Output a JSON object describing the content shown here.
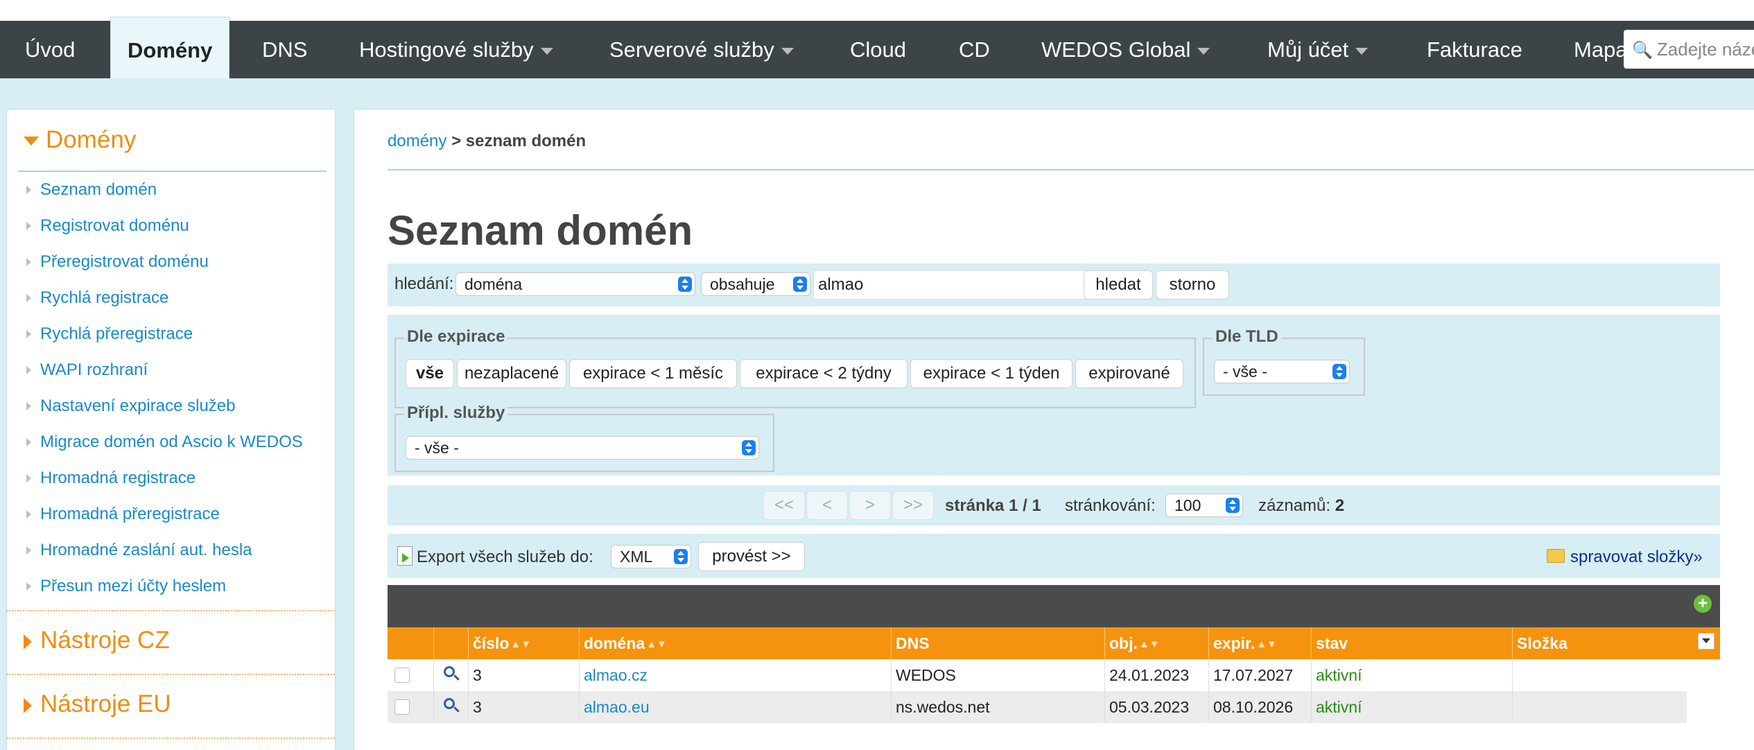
{
  "nav": {
    "items": [
      {
        "label": "Úvod"
      },
      {
        "label": "Domény"
      },
      {
        "label": "DNS"
      },
      {
        "label": "Hostingové služby"
      },
      {
        "label": "Serverové služby"
      },
      {
        "label": "Cloud"
      },
      {
        "label": "CD"
      },
      {
        "label": "WEDOS Global"
      },
      {
        "label": "Můj účet"
      },
      {
        "label": "Fakturace"
      },
      {
        "label": "Mapa"
      }
    ],
    "search_placeholder": "Zadejte náze"
  },
  "sidebar": {
    "heading": "Domény",
    "links": [
      "Seznam domén",
      "Registrovat doménu",
      "Přeregistrovat doménu",
      "Rychlá registrace",
      "Rychlá přeregistrace",
      "WAPI rozhraní",
      "Nastavení expirace služeb",
      "Migrace domén od Ascio k WEDOS",
      "Hromadná registrace",
      "Hromadná přeregistrace",
      "Hromadné zaslání aut. hesla",
      "Přesun mezi účty heslem"
    ],
    "section2": "Nástroje CZ",
    "section3": "Nástroje EU"
  },
  "breadcrumb": {
    "link": "domény",
    "sep": ">",
    "current": "seznam domén"
  },
  "page_title": "Seznam domén",
  "search": {
    "label": "hledání:",
    "field": "doména",
    "operator": "obsahuje",
    "value": "almao",
    "search_button": "hledat",
    "cancel_button": "storno"
  },
  "filters": {
    "expiry_legend": "Dle expirace",
    "expiry_buttons": [
      "vše",
      "nezaplacené",
      "expirace < 1 měsíc",
      "expirace < 2 týdny",
      "expirace < 1 týden",
      "expirované"
    ],
    "tld_legend": "Dle TLD",
    "tld_value": "- vše -",
    "extra_legend": "Přípl. služby",
    "extra_value": "- vše -"
  },
  "pagination": {
    "first": "<<",
    "prev": "<",
    "next": ">",
    "last": ">>",
    "page_label": "stránka 1 / 1",
    "per_page_label": "stránkování:",
    "per_page_value": "100",
    "records_label": "záznamů:",
    "records_value": "2"
  },
  "export": {
    "label": "Export všech služeb do:",
    "format": "XML",
    "button": "provést >>",
    "manage_folders": "spravovat složky»"
  },
  "table": {
    "columns": [
      "číslo",
      "doména",
      "DNS",
      "obj.",
      "expir.",
      "stav",
      "Složka"
    ],
    "rows": [
      {
        "number": "3",
        "domain": "almao.cz",
        "dns": "WEDOS",
        "ordered": "24.01.2023",
        "expires": "17.07.2027",
        "status": "aktivní",
        "folder": ""
      },
      {
        "number": "3",
        "domain": "almao.eu",
        "dns": "ns.wedos.net",
        "ordered": "05.03.2023",
        "expires": "08.10.2026",
        "status": "aktivní",
        "folder": ""
      }
    ]
  },
  "colors": {
    "accent": "#f5930f",
    "nav_bg": "#3d4447",
    "link": "#1a8ac6",
    "status_active": "#2a8a14"
  }
}
